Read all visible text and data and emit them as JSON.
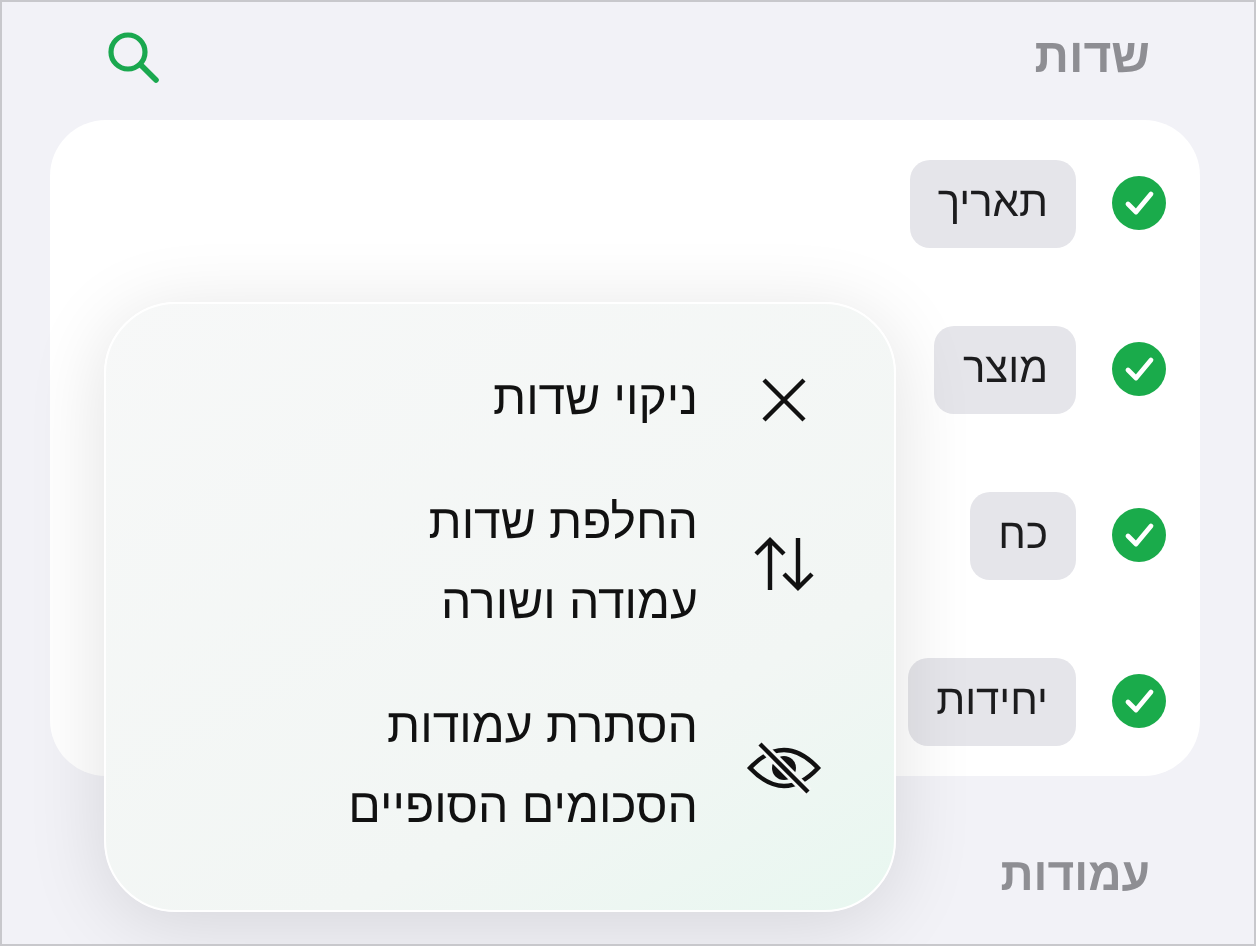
{
  "header": {
    "title": "שדות"
  },
  "fields": [
    {
      "label": "תאריך",
      "checked": true
    },
    {
      "label": "מוצר",
      "checked": true
    },
    {
      "label": "כח",
      "checked": true
    },
    {
      "label": "יחידות",
      "checked": true
    }
  ],
  "section": {
    "title": "עמודות"
  },
  "menu": [
    {
      "kind": "clear",
      "label": "ניקוי שדות"
    },
    {
      "kind": "swap",
      "label": "החלפת שדות עמודה ושורה"
    },
    {
      "kind": "hide",
      "label": "הסתרת עמודות הסכומים הסופיים"
    }
  ]
}
